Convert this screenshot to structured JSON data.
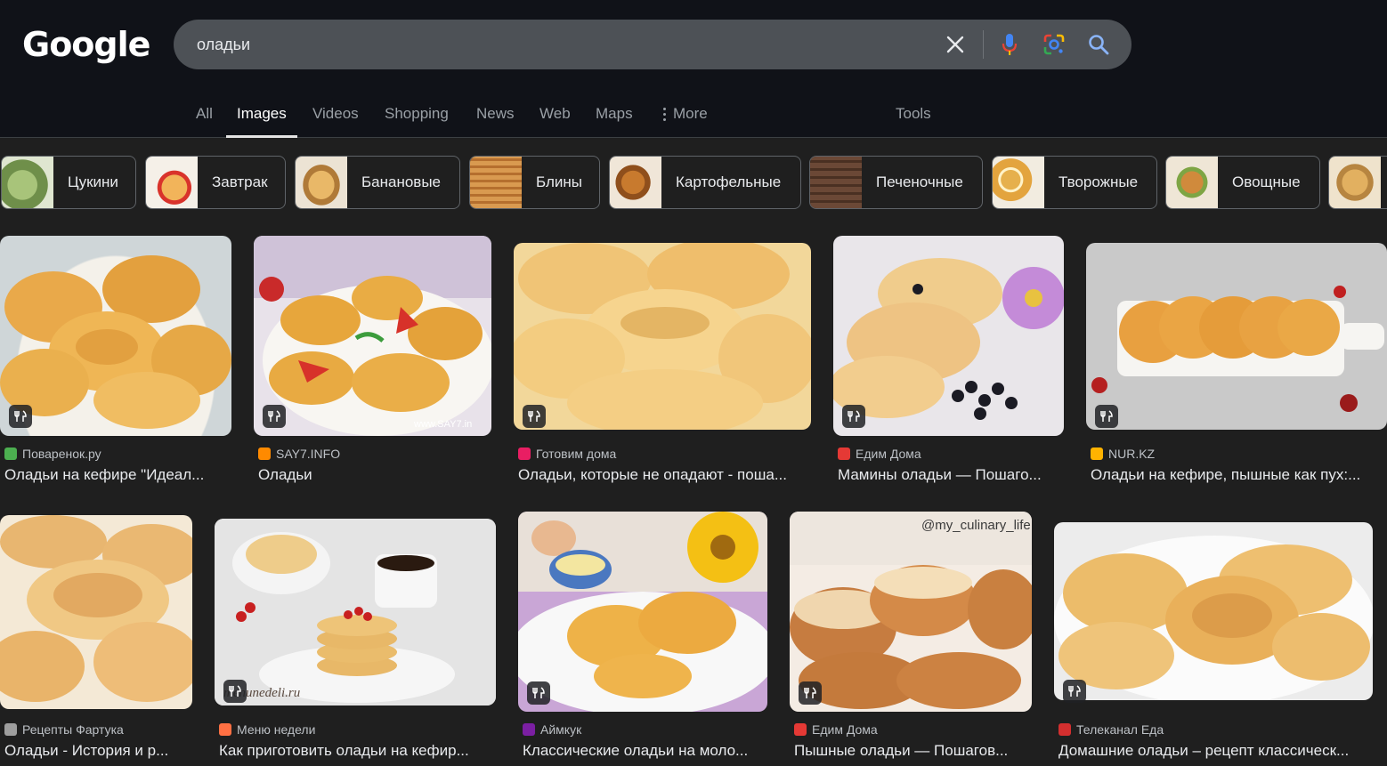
{
  "logo": "Google",
  "search": {
    "query": "оладьи"
  },
  "tabs": [
    {
      "label": "All"
    },
    {
      "label": "Images",
      "active": true
    },
    {
      "label": "Videos"
    },
    {
      "label": "Shopping"
    },
    {
      "label": "News"
    },
    {
      "label": "Web"
    },
    {
      "label": "Maps"
    },
    {
      "label": "More"
    },
    {
      "label": "Tools"
    }
  ],
  "chips": [
    {
      "label": "Цукини",
      "color": "#8aa868"
    },
    {
      "label": "Завтрак",
      "color": "#e08a4a"
    },
    {
      "label": "Банановые",
      "color": "#d9a65a"
    },
    {
      "label": "Блины",
      "color": "#c98a48"
    },
    {
      "label": "Картофельные",
      "color": "#b8682a"
    },
    {
      "label": "Печеночные",
      "color": "#6a4a36"
    },
    {
      "label": "Творожные",
      "color": "#e0a84a"
    },
    {
      "label": "Овощные",
      "color": "#c77a36"
    },
    {
      "label": "",
      "color": "#d4a15a"
    }
  ],
  "results": [
    {
      "source": "Поваренок.ру",
      "title": "Оладьи на кефире \"Идеал...",
      "fav": "#4caf50"
    },
    {
      "source": "SAY7.INFO",
      "title": "Оладьи",
      "fav": "#ff8a00"
    },
    {
      "source": "Готовим дома",
      "title": "Оладьи, которые не опадают - поша...",
      "fav": "#e91e63"
    },
    {
      "source": "Едим Дома",
      "title": "Мамины оладьи — Пошаго...",
      "fav": "#e53935"
    },
    {
      "source": "NUR.KZ",
      "title": "Оладьи на кефире, пышные как пух:...",
      "fav": "#ffb300"
    },
    {
      "source": "Рецепты Фартука",
      "title": "Оладьи - История и р...",
      "fav": "#9e9e9e"
    },
    {
      "source": "Меню недели",
      "title": "Как приготовить оладьи на кефир...",
      "fav": "#ff7043"
    },
    {
      "source": "Аймкук",
      "title": "Классические оладьи на моло...",
      "fav": "#7b1fa2"
    },
    {
      "source": "Едим Дома",
      "title": "Пышные оладьи — Пошагов...",
      "fav": "#e53935"
    },
    {
      "source": "Телеканал Еда",
      "title": "Домашние оладьи – рецепт классическ...",
      "fav": "#d32f2f"
    }
  ],
  "watermarks": {
    "say7": "www.SAY7.in",
    "menunedeli": "menunedeli.ru",
    "culinary": "@my_culinary_life"
  },
  "colors": {
    "bg": "#1f1f1f",
    "header": "#101218",
    "searchbox": "#4d5156"
  }
}
